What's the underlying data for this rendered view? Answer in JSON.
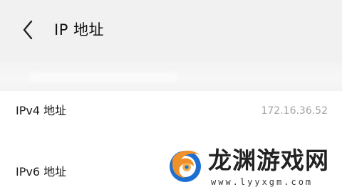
{
  "header": {
    "back_icon": "chevron-left-icon",
    "title": "IP 地址"
  },
  "rows": [
    {
      "label": "IPv4 地址",
      "value": "172.16.36.52"
    },
    {
      "label": "IPv6 地址",
      "value": ""
    }
  ],
  "watermark": {
    "title": "龙渊游戏网",
    "url": "www.lyyxgm.com"
  },
  "colors": {
    "background": "#f1f1f1",
    "card": "#ffffff",
    "value_text": "#a3a3a3",
    "logo_orange": "#f0902a",
    "logo_blue": "#1e6fd0"
  }
}
